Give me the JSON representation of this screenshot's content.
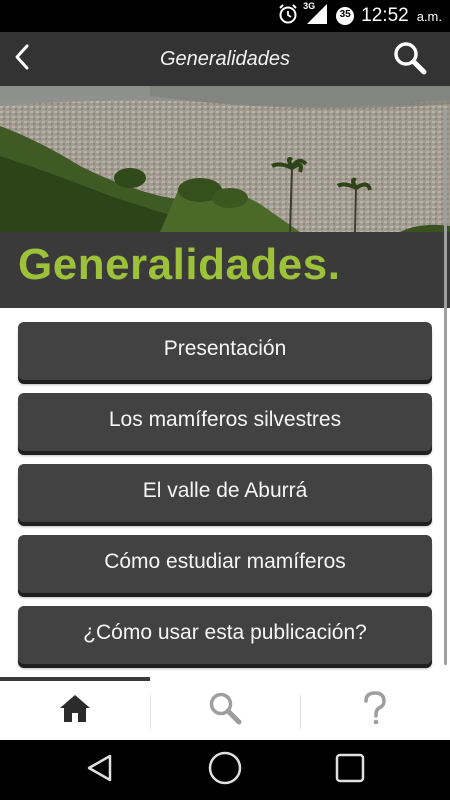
{
  "status_bar": {
    "network": "3G",
    "notification_badge": "35",
    "time": "12:52",
    "ampm": "a.m.",
    "icons": [
      "alarm-icon",
      "signal-icon",
      "badge-icon"
    ]
  },
  "app_bar": {
    "title": "Generalidades",
    "back_icon": "chevron-left-icon",
    "search_icon": "search-icon"
  },
  "hero": {
    "title": "Generalidades.",
    "title_color": "#9ec13a"
  },
  "menu": {
    "items": [
      {
        "label": "Presentación"
      },
      {
        "label": "Los mamíferos silvestres"
      },
      {
        "label": "El valle de Aburrá"
      },
      {
        "label": "Cómo estudiar mamíferos"
      },
      {
        "label": "¿Cómo usar esta publicación?"
      }
    ]
  },
  "bottom_nav": {
    "items": [
      {
        "icon": "home-icon",
        "active": true
      },
      {
        "icon": "search-icon",
        "active": false
      },
      {
        "icon": "question-icon",
        "active": false
      }
    ]
  },
  "system_nav": {
    "buttons": [
      "back-triangle-icon",
      "home-circle-icon",
      "recents-square-icon"
    ]
  },
  "colors": {
    "app_bar": "#333333",
    "button_bg": "#424242",
    "accent_green": "#9ec13a"
  }
}
